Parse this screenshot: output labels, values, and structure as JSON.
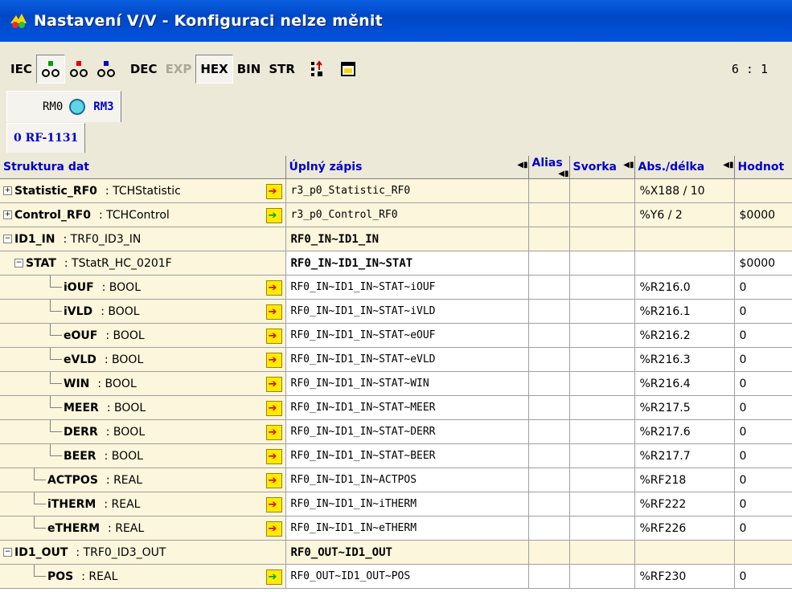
{
  "window": {
    "title": "Nastavení V/V - Konfiguraci nelze měnit"
  },
  "toolbar": {
    "iec": "IEC",
    "dec": "DEC",
    "exp": "EXP",
    "hex": "HEX",
    "bin": "BIN",
    "str": "STR",
    "ratio": "6 : 1"
  },
  "tabs_row1": {
    "rm0": "RM0",
    "rm3": "RM3"
  },
  "tabs_row2": {
    "rf": "0 RF-1131"
  },
  "columns": {
    "c1": "Struktura dat",
    "c2": "Úplný zápis",
    "c3": "Alias",
    "c4": "Svorka",
    "c5": "Abs./délka",
    "c6": "Hodnot"
  },
  "rows": [
    {
      "name": "Statistic_RF0",
      "type": ": TCHStatistic",
      "full": "r3_p0_Statistic_RF0",
      "abs": "%X188 / 10",
      "val": "",
      "arrow": "red"
    },
    {
      "name": "Control_RF0",
      "type": ": TCHControl",
      "full": "r3_p0_Control_RF0",
      "abs": "%Y6 / 2",
      "val": "$0000",
      "arrow": "green"
    },
    {
      "name": "ID1_IN",
      "type": ": TRF0_ID3_IN",
      "full": "RF0_IN~ID1_IN",
      "abs": "",
      "val": "",
      "arrow": ""
    },
    {
      "name": "STAT",
      "type": ": TStatR_HC_0201F",
      "full": "RF0_IN~ID1_IN~STAT",
      "abs": "",
      "val": "$0000",
      "arrow": ""
    },
    {
      "name": "iOUF",
      "type": ": BOOL",
      "full": "RF0_IN~ID1_IN~STAT~iOUF",
      "abs": "%R216.0",
      "val": "0",
      "arrow": "red"
    },
    {
      "name": "iVLD",
      "type": ": BOOL",
      "full": "RF0_IN~ID1_IN~STAT~iVLD",
      "abs": "%R216.1",
      "val": "0",
      "arrow": "red"
    },
    {
      "name": "eOUF",
      "type": ": BOOL",
      "full": "RF0_IN~ID1_IN~STAT~eOUF",
      "abs": "%R216.2",
      "val": "0",
      "arrow": "red"
    },
    {
      "name": "eVLD",
      "type": ": BOOL",
      "full": "RF0_IN~ID1_IN~STAT~eVLD",
      "abs": "%R216.3",
      "val": "0",
      "arrow": "red"
    },
    {
      "name": "WIN",
      "type": ": BOOL",
      "full": "RF0_IN~ID1_IN~STAT~WIN",
      "abs": "%R216.4",
      "val": "0",
      "arrow": "red"
    },
    {
      "name": "MEER",
      "type": ": BOOL",
      "full": "RF0_IN~ID1_IN~STAT~MEER",
      "abs": "%R217.5",
      "val": "0",
      "arrow": "red"
    },
    {
      "name": "DERR",
      "type": ": BOOL",
      "full": "RF0_IN~ID1_IN~STAT~DERR",
      "abs": "%R217.6",
      "val": "0",
      "arrow": "red"
    },
    {
      "name": "BEER",
      "type": ": BOOL",
      "full": "RF0_IN~ID1_IN~STAT~BEER",
      "abs": "%R217.7",
      "val": "0",
      "arrow": "red"
    },
    {
      "name": "ACTPOS",
      "type": ": REAL",
      "full": "RF0_IN~ID1_IN~ACTPOS",
      "abs": "%RF218",
      "val": "0",
      "arrow": "red"
    },
    {
      "name": "iTHERM",
      "type": ": REAL",
      "full": "RF0_IN~ID1_IN~iTHERM",
      "abs": "%RF222",
      "val": "0",
      "arrow": "red"
    },
    {
      "name": "eTHERM",
      "type": ": REAL",
      "full": "RF0_IN~ID1_IN~eTHERM",
      "abs": "%RF226",
      "val": "0",
      "arrow": "red"
    },
    {
      "name": "ID1_OUT",
      "type": ": TRF0_ID3_OUT",
      "full": "RF0_OUT~ID1_OUT",
      "abs": "",
      "val": "",
      "arrow": ""
    },
    {
      "name": "POS",
      "type": ": REAL",
      "full": "RF0_OUT~ID1_OUT~POS",
      "abs": "%RF230",
      "val": "0",
      "arrow": "green"
    }
  ]
}
